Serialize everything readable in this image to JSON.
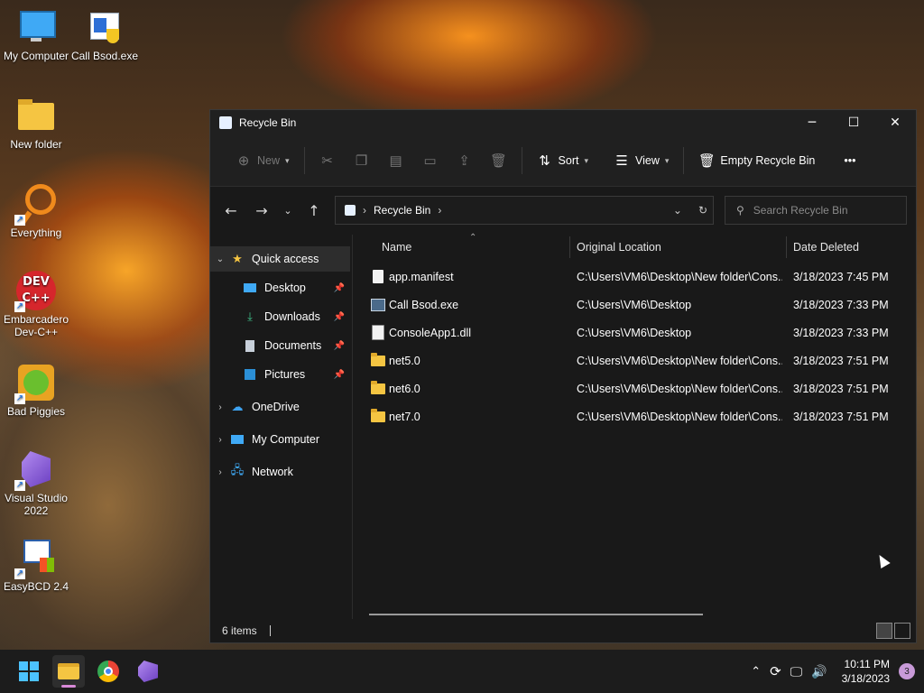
{
  "desktop": {
    "icons": [
      {
        "label": "My Computer",
        "icon": "monitor-icon"
      },
      {
        "label": "Call Bsod.exe",
        "icon": "exe-shield-icon"
      },
      {
        "label": "New folder",
        "icon": "folder-icon"
      },
      {
        "label": "Everything",
        "icon": "magnifier-icon"
      },
      {
        "label": "Embarcadero Dev-C++",
        "icon": "devcpp-icon"
      },
      {
        "label": "Bad Piggies",
        "icon": "bad-piggies-icon"
      },
      {
        "label": "Visual Studio 2022",
        "icon": "visual-studio-icon"
      },
      {
        "label": "EasyBCD 2.4",
        "icon": "easybcd-icon"
      }
    ]
  },
  "window": {
    "title": "Recycle Bin",
    "controls": {
      "minimize": "─",
      "maximize": "☐",
      "close": "✕"
    }
  },
  "toolbar": {
    "new_label": "New",
    "sort_label": "Sort",
    "view_label": "View",
    "empty_label": "Empty Recycle Bin",
    "more": "•••"
  },
  "address": {
    "crumb": "Recycle Bin",
    "search_placeholder": "Search Recycle Bin"
  },
  "nav": {
    "quick_access": "Quick access",
    "pinned": [
      {
        "label": "Desktop",
        "icon": "desktop-icon"
      },
      {
        "label": "Downloads",
        "icon": "download-icon"
      },
      {
        "label": "Documents",
        "icon": "documents-icon"
      },
      {
        "label": "Pictures",
        "icon": "pictures-icon"
      }
    ],
    "onedrive": "OneDrive",
    "my_computer": "My Computer",
    "network": "Network"
  },
  "columns": {
    "name": "Name",
    "location": "Original Location",
    "date": "Date Deleted"
  },
  "files": [
    {
      "name": "app.manifest",
      "location": "C:\\Users\\VM6\\Desktop\\New folder\\Cons...",
      "date": "3/18/2023 7:45 PM",
      "type": "file"
    },
    {
      "name": "Call Bsod.exe",
      "location": "C:\\Users\\VM6\\Desktop",
      "date": "3/18/2023 7:33 PM",
      "type": "exe"
    },
    {
      "name": "ConsoleApp1.dll",
      "location": "C:\\Users\\VM6\\Desktop",
      "date": "3/18/2023 7:33 PM",
      "type": "dll"
    },
    {
      "name": "net5.0",
      "location": "C:\\Users\\VM6\\Desktop\\New folder\\Cons...",
      "date": "3/18/2023 7:51 PM",
      "type": "folder"
    },
    {
      "name": "net6.0",
      "location": "C:\\Users\\VM6\\Desktop\\New folder\\Cons...",
      "date": "3/18/2023 7:51 PM",
      "type": "folder"
    },
    {
      "name": "net7.0",
      "location": "C:\\Users\\VM6\\Desktop\\New folder\\Cons...",
      "date": "3/18/2023 7:51 PM",
      "type": "folder"
    }
  ],
  "status": {
    "items": "6 items"
  },
  "taskbar": {
    "time": "10:11 PM",
    "date": "3/18/2023",
    "notifications": "3"
  }
}
